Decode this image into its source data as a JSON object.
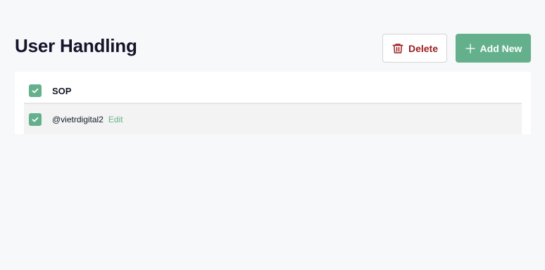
{
  "page": {
    "title": "User Handling"
  },
  "toolbar": {
    "delete_label": "Delete",
    "add_label": "Add New"
  },
  "table": {
    "header": {
      "label": "SOP",
      "checked": true
    },
    "rows": [
      {
        "handle": "@vietrdigital2",
        "action": "Edit",
        "checked": true
      }
    ]
  },
  "colors": {
    "accent": "#65b08c",
    "danger": "#9b1c1c",
    "background": "#f7f8fa"
  },
  "icons": {
    "delete": "trash-icon",
    "add": "plus-icon",
    "check": "checkmark-icon"
  }
}
